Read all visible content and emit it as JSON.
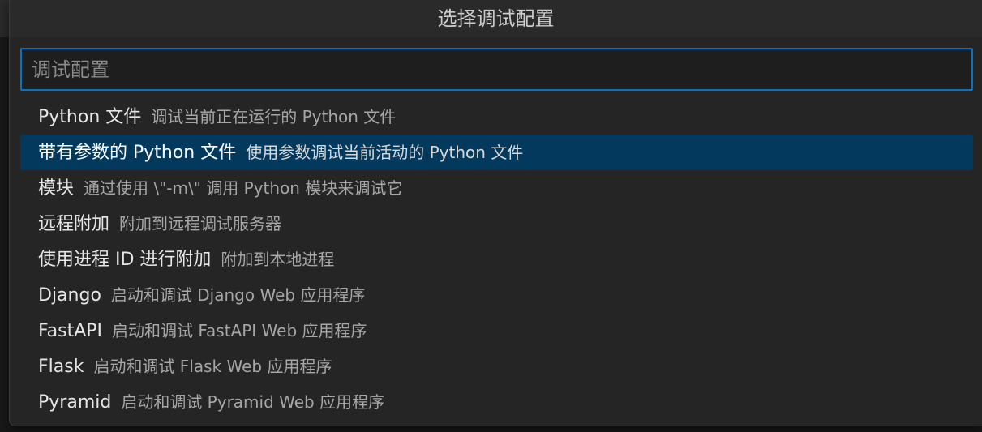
{
  "quick_pick": {
    "title": "选择调试配置",
    "input_placeholder": "调试配置",
    "input_value": "",
    "items": [
      {
        "label": "Python 文件",
        "description": "调试当前正在运行的 Python 文件",
        "selected": false
      },
      {
        "label": "带有参数的 Python 文件",
        "description": "使用参数调试当前活动的 Python 文件",
        "selected": true
      },
      {
        "label": "模块",
        "description": "通过使用 \\\"-m\\\" 调用 Python 模块来调试它",
        "selected": false
      },
      {
        "label": "远程附加",
        "description": "附加到远程调试服务器",
        "selected": false
      },
      {
        "label": "使用进程 ID 进行附加",
        "description": "附加到本地进程",
        "selected": false
      },
      {
        "label": "Django",
        "description": "启动和调试 Django Web 应用程序",
        "selected": false
      },
      {
        "label": "FastAPI",
        "description": "启动和调试 FastAPI Web 应用程序",
        "selected": false
      },
      {
        "label": "Flask",
        "description": "启动和调试 Flask Web 应用程序",
        "selected": false
      },
      {
        "label": "Pyramid",
        "description": "启动和调试 Pyramid Web 应用程序",
        "selected": false
      }
    ]
  },
  "colors": {
    "accent_border": "#0e70c0",
    "selected_background": "#04395e",
    "panel_background": "#252526"
  }
}
